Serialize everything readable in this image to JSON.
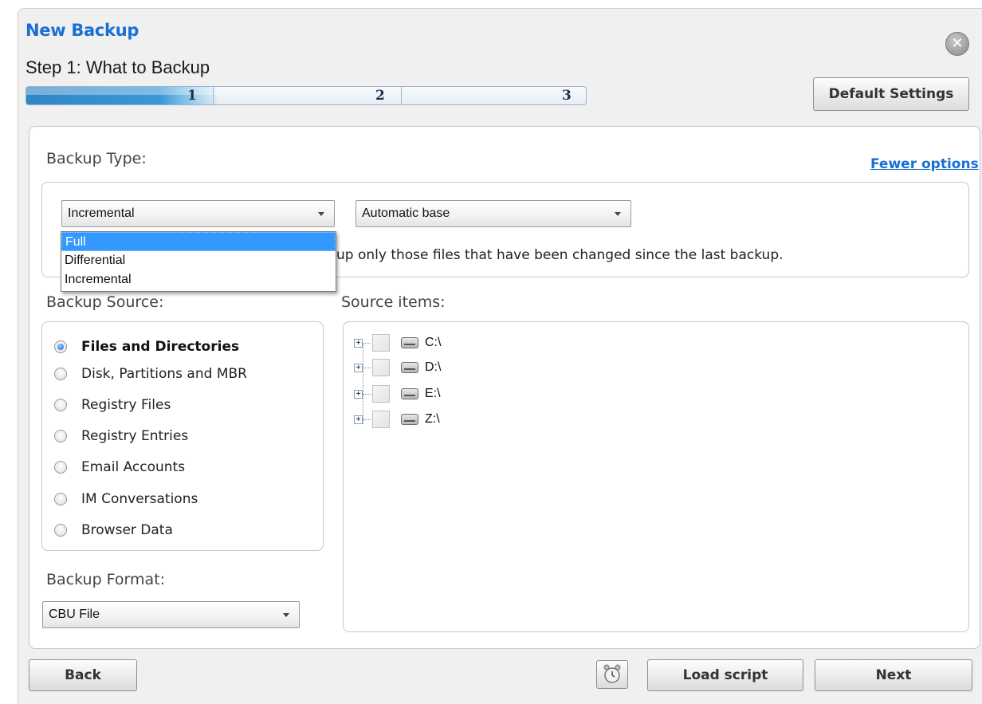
{
  "window": {
    "title": "New Backup",
    "step_title": "Step 1: What to Backup",
    "default_settings_label": "Default Settings",
    "close_icon": "close-icon"
  },
  "progress": {
    "steps": [
      "1",
      "2",
      "3"
    ],
    "current_step": 1,
    "fill_fraction": 0.34
  },
  "backup_type": {
    "label": "Backup Type:",
    "fewer_options_label": "Fewer options",
    "type_selected": "Incremental",
    "type_options": [
      "Full",
      "Differential",
      "Incremental"
    ],
    "highlighted_option": "Full",
    "base_selected": "Automatic base",
    "description_visible": "up only those files that have been changed since the last backup."
  },
  "backup_source": {
    "label": "Backup Source:",
    "options": [
      "Files and Directories",
      "Disk, Partitions and MBR",
      "Registry Files",
      "Registry Entries",
      "Email Accounts",
      "IM Conversations",
      "Browser Data"
    ],
    "selected_index": 0
  },
  "source_items": {
    "label": "Source items:",
    "drives": [
      "C:\\",
      "D:\\",
      "E:\\",
      "Z:\\"
    ]
  },
  "backup_format": {
    "label": "Backup Format:",
    "selected": "CBU File"
  },
  "footer": {
    "back_label": "Back",
    "load_script_label": "Load script",
    "next_label": "Next",
    "schedule_icon": "alarm-clock-icon"
  },
  "colors": {
    "title_blue": "#1a6fd4",
    "progress_fill": "#2f86c7",
    "selection": "#3399ff"
  }
}
